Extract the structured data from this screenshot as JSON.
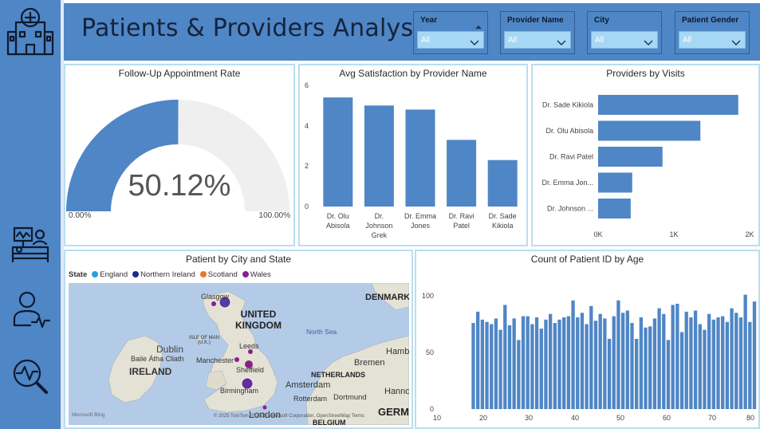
{
  "header": {
    "title": "Patients & Providers Analysis",
    "slicers": [
      {
        "label": "Year",
        "value": "All"
      },
      {
        "label": "Provider Name",
        "value": "All"
      },
      {
        "label": "City",
        "value": "All"
      },
      {
        "label": "Patient Gender",
        "value": "All"
      }
    ]
  },
  "sidebar": {
    "icons": [
      "hospital-icon",
      "patient-bed-icon",
      "provider-icon",
      "analysis-icon"
    ]
  },
  "colors": {
    "primary": "#4F86C6",
    "bar": "#4F86C6",
    "england": "#2E9BE0",
    "northern_ireland": "#1A2B8C",
    "scotland": "#E8772E",
    "wales": "#8B1F8F"
  },
  "gauge": {
    "title": "Follow-Up Appointment Rate",
    "value_label": "50.12%",
    "value": 50.12,
    "min_label": "0.00%",
    "max_label": "100.00%"
  },
  "satisfaction": {
    "title": "Avg Satisfaction by Provider Name",
    "yticks": [
      "6",
      "4",
      "2",
      "0"
    ]
  },
  "visits": {
    "title": "Providers by Visits",
    "xticks": [
      "0K",
      "1K",
      "2K"
    ]
  },
  "map": {
    "title": "Patient by City and State",
    "legend_title": "State",
    "legend": [
      "England",
      "Northern Ireland",
      "Scotland",
      "Wales"
    ],
    "labels": {
      "glasgow": "Glasgow",
      "uk": "UNITED KINGDOM",
      "isle": "ISLE OF MAN (U.K.)",
      "dublin": "Dublin",
      "baile": "Baile Átha Cliath",
      "ireland": "IRELAND",
      "leeds": "Leeds",
      "manchester": "Manchester",
      "sheffield": "Sheffield",
      "birmingham": "Birmingham",
      "london": "London",
      "northsea": "North Sea",
      "denmark": "DENMARK",
      "netherlands": "NETHERLANDS",
      "amsterdam": "Amsterdam",
      "rotterdam": "Rotterdam",
      "bremen": "Bremen",
      "hamburg": "Hamb",
      "hannover": "Hanno",
      "dortmund": "Dortmund",
      "germany": "GERM",
      "belgium": "BELGIUM",
      "bing": "Microsoft Bing",
      "copyright": "© 2025 TomTom, © 2025 Microsoft Corporation, OpenStreetMap  Terms"
    }
  },
  "age_chart": {
    "title": "Count of Patient ID by Age",
    "yticks": [
      "100",
      "50",
      "0"
    ],
    "xticks": [
      "10",
      "20",
      "30",
      "40",
      "50",
      "60",
      "70",
      "80"
    ]
  },
  "chart_data": [
    {
      "type": "bar",
      "title": "Avg Satisfaction by Provider Name",
      "categories": [
        "Dr. Olu Abisola",
        "Dr. Johnson Grek",
        "Dr. Emma Jones",
        "Dr. Ravi Patel",
        "Dr. Sade Kikiola"
      ],
      "category_lines": [
        [
          "Dr. Olu",
          "Abisola"
        ],
        [
          "Dr.",
          "Johnson",
          "Grek"
        ],
        [
          "Dr. Emma",
          "Jones"
        ],
        [
          "Dr. Ravi",
          "Patel"
        ],
        [
          "Dr. Sade",
          "Kikiola"
        ]
      ],
      "values": [
        5.4,
        5.0,
        4.8,
        3.3,
        2.3
      ],
      "ylim": [
        0,
        6
      ]
    },
    {
      "type": "bar",
      "orientation": "horizontal",
      "title": "Providers by Visits",
      "categories": [
        "Dr. Sade Kikiola",
        "Dr. Olu Abisola",
        "Dr. Ravi Patel",
        "Dr. Emma Jon...",
        "Dr. Johnson ..."
      ],
      "values": [
        1850,
        1350,
        850,
        450,
        430
      ],
      "xlim": [
        0,
        2000
      ]
    },
    {
      "type": "bar",
      "title": "Count of Patient ID by Age",
      "x": [
        18,
        19,
        20,
        21,
        22,
        23,
        24,
        25,
        26,
        27,
        28,
        29,
        30,
        31,
        32,
        33,
        34,
        35,
        36,
        37,
        38,
        39,
        40,
        41,
        42,
        43,
        44,
        45,
        46,
        47,
        48,
        49,
        50,
        51,
        52,
        53,
        54,
        55,
        56,
        57,
        58,
        59,
        60,
        61,
        62,
        63,
        64,
        65,
        66,
        67,
        68,
        69,
        70,
        71,
        72,
        73,
        74,
        75,
        76,
        77,
        78,
        79,
        80
      ],
      "values": [
        76,
        86,
        79,
        77,
        75,
        80,
        70,
        92,
        74,
        80,
        61,
        82,
        82,
        75,
        81,
        71,
        79,
        84,
        76,
        79,
        81,
        82,
        96,
        81,
        85,
        75,
        91,
        78,
        84,
        80,
        62,
        82,
        96,
        85,
        87,
        76,
        62,
        81,
        72,
        73,
        80,
        89,
        84,
        61,
        92,
        93,
        68,
        86,
        81,
        87,
        75,
        70,
        84,
        79,
        81,
        82,
        77,
        89,
        85,
        81,
        101,
        77,
        95
      ],
      "ylim": [
        0,
        110
      ]
    }
  ]
}
